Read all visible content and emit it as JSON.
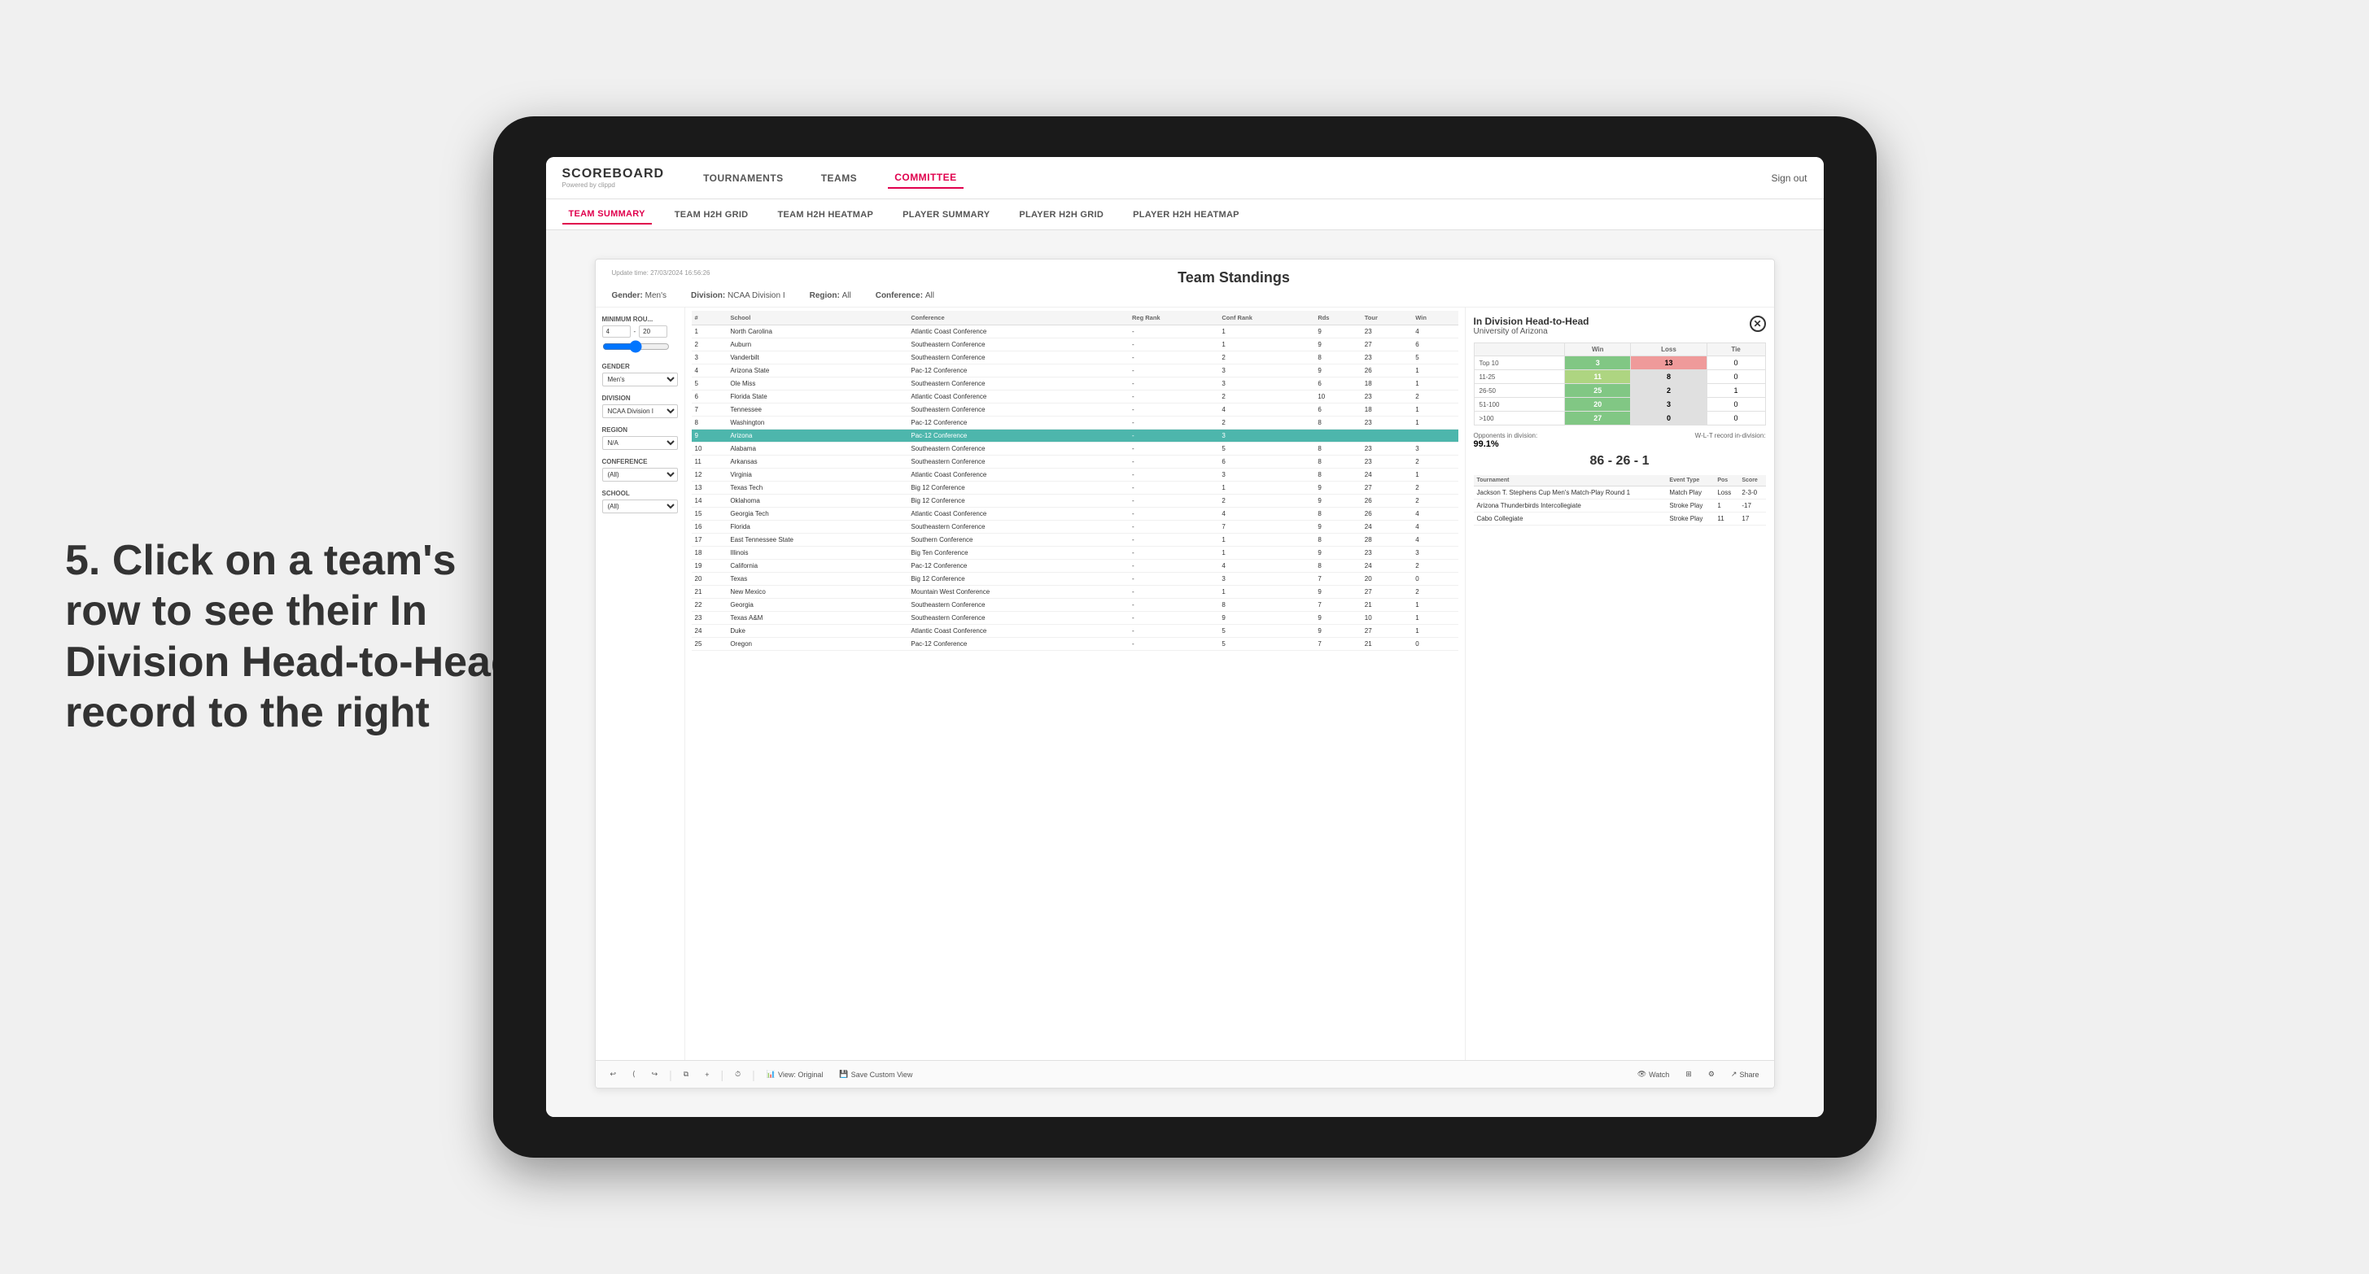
{
  "annotation": {
    "text": "5. Click on a team's row to see their In Division Head-to-Head record to the right"
  },
  "topNav": {
    "logo": "SCOREBOARD",
    "logoSub": "Powered by clippd",
    "items": [
      "TOURNAMENTS",
      "TEAMS",
      "COMMITTEE"
    ],
    "activeItem": "COMMITTEE",
    "signOut": "Sign out"
  },
  "subNav": {
    "items": [
      "TEAM SUMMARY",
      "TEAM H2H GRID",
      "TEAM H2H HEATMAP",
      "PLAYER SUMMARY",
      "PLAYER H2H GRID",
      "PLAYER H2H HEATMAP"
    ],
    "activeItem": "PLAYER SUMMARY"
  },
  "standings": {
    "updateTime": "Update time: 27/03/2024 16:56:26",
    "title": "Team Standings",
    "gender": "Men's",
    "division": "NCAA Division I",
    "region": "All",
    "conference": "All"
  },
  "filters": {
    "minimumRoundsLabel": "Minimum Rou...",
    "minValue": "4",
    "maxValue": "20",
    "genderLabel": "Gender",
    "genderValue": "Men's",
    "divisionLabel": "Division",
    "divisionValue": "NCAA Division I",
    "regionLabel": "Region",
    "regionValue": "N/A",
    "conferenceLabel": "Conference",
    "conferenceValue": "(All)",
    "schoolLabel": "School",
    "schoolValue": "(All)"
  },
  "tableColumns": [
    "#",
    "School",
    "Conference",
    "Reg Rank",
    "Conf Rank",
    "Rds",
    "Tour",
    "Win"
  ],
  "tableRows": [
    {
      "rank": "1",
      "school": "North Carolina",
      "conference": "Atlantic Coast Conference",
      "regRank": "-",
      "confRank": "1",
      "rds": "9",
      "tour": "23",
      "win": "4"
    },
    {
      "rank": "2",
      "school": "Auburn",
      "conference": "Southeastern Conference",
      "regRank": "-",
      "confRank": "1",
      "rds": "9",
      "tour": "27",
      "win": "6"
    },
    {
      "rank": "3",
      "school": "Vanderbilt",
      "conference": "Southeastern Conference",
      "regRank": "-",
      "confRank": "2",
      "rds": "8",
      "tour": "23",
      "win": "5"
    },
    {
      "rank": "4",
      "school": "Arizona State",
      "conference": "Pac-12 Conference",
      "regRank": "-",
      "confRank": "3",
      "rds": "9",
      "tour": "26",
      "win": "1"
    },
    {
      "rank": "5",
      "school": "Ole Miss",
      "conference": "Southeastern Conference",
      "regRank": "-",
      "confRank": "3",
      "rds": "6",
      "tour": "18",
      "win": "1"
    },
    {
      "rank": "6",
      "school": "Florida State",
      "conference": "Atlantic Coast Conference",
      "regRank": "-",
      "confRank": "2",
      "rds": "10",
      "tour": "23",
      "win": "2"
    },
    {
      "rank": "7",
      "school": "Tennessee",
      "conference": "Southeastern Conference",
      "regRank": "-",
      "confRank": "4",
      "rds": "6",
      "tour": "18",
      "win": "1"
    },
    {
      "rank": "8",
      "school": "Washington",
      "conference": "Pac-12 Conference",
      "regRank": "-",
      "confRank": "2",
      "rds": "8",
      "tour": "23",
      "win": "1"
    },
    {
      "rank": "9",
      "school": "Arizona",
      "conference": "Pac-12 Conference",
      "regRank": "-",
      "confRank": "3",
      "rds": "",
      "tour": "",
      "win": "",
      "highlighted": true
    },
    {
      "rank": "10",
      "school": "Alabama",
      "conference": "Southeastern Conference",
      "regRank": "-",
      "confRank": "5",
      "rds": "8",
      "tour": "23",
      "win": "3"
    },
    {
      "rank": "11",
      "school": "Arkansas",
      "conference": "Southeastern Conference",
      "regRank": "-",
      "confRank": "6",
      "rds": "8",
      "tour": "23",
      "win": "2"
    },
    {
      "rank": "12",
      "school": "Virginia",
      "conference": "Atlantic Coast Conference",
      "regRank": "-",
      "confRank": "3",
      "rds": "8",
      "tour": "24",
      "win": "1"
    },
    {
      "rank": "13",
      "school": "Texas Tech",
      "conference": "Big 12 Conference",
      "regRank": "-",
      "confRank": "1",
      "rds": "9",
      "tour": "27",
      "win": "2"
    },
    {
      "rank": "14",
      "school": "Oklahoma",
      "conference": "Big 12 Conference",
      "regRank": "-",
      "confRank": "2",
      "rds": "9",
      "tour": "26",
      "win": "2"
    },
    {
      "rank": "15",
      "school": "Georgia Tech",
      "conference": "Atlantic Coast Conference",
      "regRank": "-",
      "confRank": "4",
      "rds": "8",
      "tour": "26",
      "win": "4"
    },
    {
      "rank": "16",
      "school": "Florida",
      "conference": "Southeastern Conference",
      "regRank": "-",
      "confRank": "7",
      "rds": "9",
      "tour": "24",
      "win": "4"
    },
    {
      "rank": "17",
      "school": "East Tennessee State",
      "conference": "Southern Conference",
      "regRank": "-",
      "confRank": "1",
      "rds": "8",
      "tour": "28",
      "win": "4"
    },
    {
      "rank": "18",
      "school": "Illinois",
      "conference": "Big Ten Conference",
      "regRank": "-",
      "confRank": "1",
      "rds": "9",
      "tour": "23",
      "win": "3"
    },
    {
      "rank": "19",
      "school": "California",
      "conference": "Pac-12 Conference",
      "regRank": "-",
      "confRank": "4",
      "rds": "8",
      "tour": "24",
      "win": "2"
    },
    {
      "rank": "20",
      "school": "Texas",
      "conference": "Big 12 Conference",
      "regRank": "-",
      "confRank": "3",
      "rds": "7",
      "tour": "20",
      "win": "0"
    },
    {
      "rank": "21",
      "school": "New Mexico",
      "conference": "Mountain West Conference",
      "regRank": "-",
      "confRank": "1",
      "rds": "9",
      "tour": "27",
      "win": "2"
    },
    {
      "rank": "22",
      "school": "Georgia",
      "conference": "Southeastern Conference",
      "regRank": "-",
      "confRank": "8",
      "rds": "7",
      "tour": "21",
      "win": "1"
    },
    {
      "rank": "23",
      "school": "Texas A&M",
      "conference": "Southeastern Conference",
      "regRank": "-",
      "confRank": "9",
      "rds": "9",
      "tour": "10",
      "win": "1"
    },
    {
      "rank": "24",
      "school": "Duke",
      "conference": "Atlantic Coast Conference",
      "regRank": "-",
      "confRank": "5",
      "rds": "9",
      "tour": "27",
      "win": "1"
    },
    {
      "rank": "25",
      "school": "Oregon",
      "conference": "Pac-12 Conference",
      "regRank": "-",
      "confRank": "5",
      "rds": "7",
      "tour": "21",
      "win": "0"
    }
  ],
  "h2h": {
    "title": "In Division Head-to-Head",
    "school": "University of Arizona",
    "tableHeaders": [
      "",
      "Win",
      "Loss",
      "Tie"
    ],
    "tableRows": [
      {
        "label": "Top 10",
        "win": "3",
        "loss": "13",
        "tie": "0",
        "winClass": "cell-green",
        "lossClass": "cell-red"
      },
      {
        "label": "11-25",
        "win": "11",
        "loss": "8",
        "tie": "0",
        "winClass": "cell-yellow2",
        "lossClass": ""
      },
      {
        "label": "26-50",
        "win": "25",
        "loss": "2",
        "tie": "1",
        "winClass": "cell-green",
        "lossClass": ""
      },
      {
        "label": "51-100",
        "win": "20",
        "loss": "3",
        "tie": "0",
        "winClass": "cell-green",
        "lossClass": ""
      },
      {
        "label": ">100",
        "win": "27",
        "loss": "0",
        "tie": "0",
        "winClass": "cell-green",
        "lossClass": ""
      }
    ],
    "opponentsLabel": "Opponents in division:",
    "opponentsValue": "99.1%",
    "recordLabel": "W-L-T record in-division:",
    "record": "86 - 26 - 1",
    "tournamentColumns": [
      "Tournament",
      "Event Type",
      "Pos",
      "Score"
    ],
    "tournaments": [
      {
        "name": "Jackson T. Stephens Cup Men's Match-Play Round 1",
        "type": "Match Play",
        "pos": "Loss",
        "score": "2-3-0"
      },
      {
        "name": "Arizona Thunderbirds Intercollegiate",
        "type": "Stroke Play",
        "pos": "1",
        "score": "-17"
      },
      {
        "name": "Cabo Collegiate",
        "type": "Stroke Play",
        "pos": "11",
        "score": "17"
      }
    ]
  },
  "toolbar": {
    "undoLabel": "↩",
    "redoLabel": "↪",
    "viewOriginalLabel": "View: Original",
    "saveCustomLabel": "Save Custom View",
    "watchLabel": "Watch",
    "shareLabel": "Share"
  }
}
